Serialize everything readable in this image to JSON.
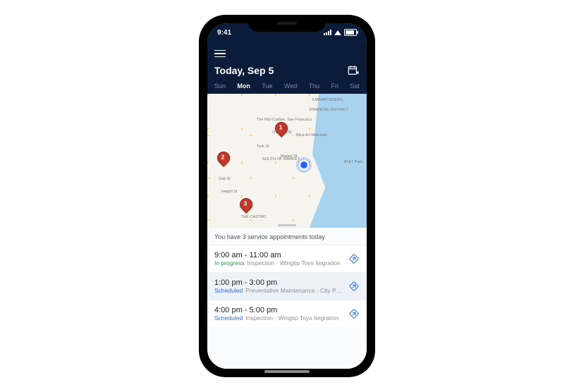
{
  "status_bar": {
    "time": "9:41"
  },
  "header": {
    "title": "Today, Sep 5",
    "days": [
      {
        "label": "Sun",
        "active": false
      },
      {
        "label": "Mon",
        "active": true
      },
      {
        "label": "Tue",
        "active": false
      },
      {
        "label": "Wed",
        "active": false
      },
      {
        "label": "Thu",
        "active": false
      },
      {
        "label": "Fri",
        "active": false
      },
      {
        "label": "Sat",
        "active": false
      }
    ]
  },
  "map": {
    "labels": {
      "ritz": "The Ritz-Carlton, San Francisco",
      "blick": "Blick Art Materials",
      "att": "AT&T Park",
      "embarcadero": "EMBARCADERO",
      "financial": "FINANCIAL DISTRICT",
      "soma": "SOUTH OF MARKET",
      "castro": "THE CASTRO",
      "turk": "Turk St",
      "market": "Market St",
      "ofarrell": "O'Farrell St",
      "oak": "Oak St",
      "haight": "Haight St"
    },
    "pins": {
      "p1": "1",
      "p2": "2",
      "p3": "3"
    }
  },
  "summary": "You have 3 service appointments today",
  "appointments": [
    {
      "time": "9:00 am - 11:00 am",
      "status": "In progress",
      "status_kind": "inprogress",
      "detail": "Inspection · Wingtip Toys Itegration",
      "selected": false
    },
    {
      "time": "1:00 pm - 3:00 pm",
      "status": "Scheduled",
      "status_kind": "scheduled",
      "detail": "Preventative Maintenance · City Power…",
      "selected": true
    },
    {
      "time": "4:00 pm - 5:00 pm",
      "status": "Scheduled",
      "status_kind": "scheduled",
      "detail": "Inspection · Wingtip Toys Itegration",
      "selected": false
    }
  ]
}
